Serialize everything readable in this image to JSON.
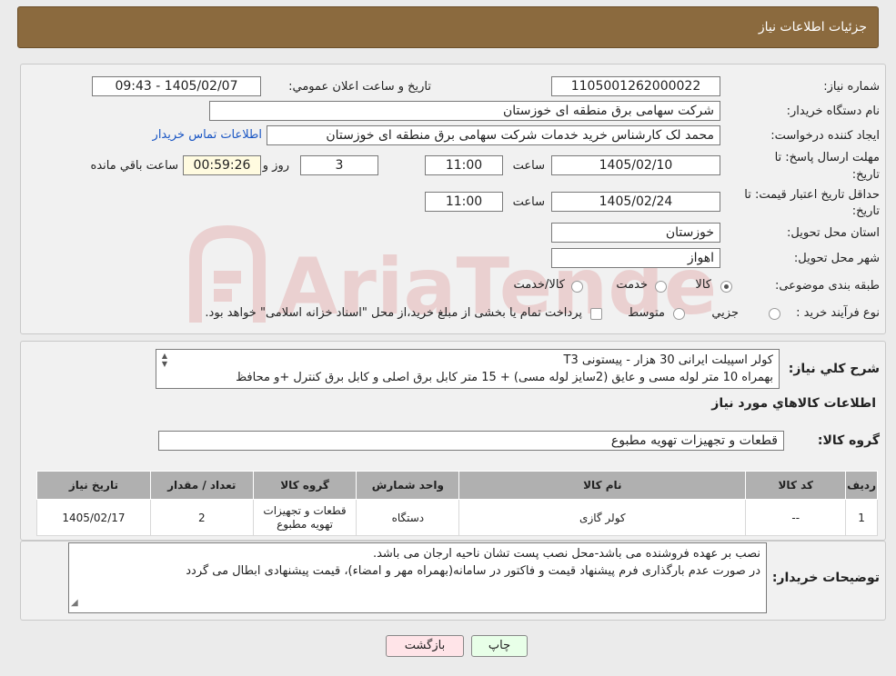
{
  "header": {
    "title": "جزئیات اطلاعات نیاز"
  },
  "form": {
    "need_number_label": "شماره نیاز:",
    "need_number": "1105001262000022",
    "announce_label": "تاریخ و ساعت اعلان عمومي:",
    "announce_value": "1405/02/07 - 09:43",
    "buyer_label": "نام دستگاه خريدار:",
    "buyer_value": "شرکت سهامی برق منطقه ای خوزستان",
    "creator_label": "ايجاد کننده درخواست:",
    "creator_value": "محمد لک کارشناس خرید خدمات شرکت سهامی برق منطقه ای خوزستان",
    "contact_link": "اطلاعات تماس خريدار",
    "deadline_label_1": "مهلت ارسال پاسخ: تا",
    "deadline_label_2": "تاريخ:",
    "deadline_date": "1405/02/10",
    "time_label": "ساعت",
    "deadline_time": "11:00",
    "days_value": "3",
    "days_label": "روز و",
    "remaining_time": "00:59:26",
    "remaining_label": "ساعت باقي مانده",
    "validity_label_1": "حداقل تاريخ اعتبار قيمت: تا",
    "validity_label_2": "تاريخ:",
    "validity_date": "1405/02/24",
    "validity_time": "11:00",
    "province_label": "استان محل تحويل:",
    "province_value": "خوزستان",
    "city_label": "شهر محل تحويل:",
    "city_value": "اهواز",
    "category_label": "طبقه بندی موضوعی:",
    "category_options": [
      "کالا",
      "خدمت",
      "کالا/خدمت"
    ],
    "process_label": "نوع فرآيند خريد :",
    "process_options": [
      "جزيي",
      "متوسط"
    ],
    "process_note": "پرداخت تمام یا بخشی از مبلغ خرید،از محل \"اسناد خزانه اسلامی\" خواهد بود."
  },
  "description": {
    "label": "شرح کلي نياز:",
    "line1": "کولر اسپیلت ایرانی 30 هزار - پیستونی T3",
    "line2": "بهمراه 10 متر لوله مسی و عایق (2سایز لوله مسی) + 15 متر کابل برق اصلی و کابل برق کنترل +و محافظ"
  },
  "goods": {
    "section_title": "اطلاعات کالاهاي مورد نياز",
    "group_label": "گروه کالا:",
    "group_value": "قطعات و تجهیزات تهویه مطبوع",
    "columns": [
      "رديف",
      "کد کالا",
      "نام کالا",
      "واحد شمارش",
      "گروه کالا",
      "تعداد / مقدار",
      "تاريخ نياز"
    ],
    "rows": [
      {
        "row": "1",
        "code": "--",
        "name": "کولر گازی",
        "unit": "دستگاه",
        "group": "قطعات و تجهیزات تهویه مطبوع",
        "qty": "2",
        "date": "1405/02/17"
      }
    ]
  },
  "notes": {
    "label": "توضيحات خريدار:",
    "line1": "نصب بر عهده فروشنده می باشد-محل نصب پست تشان ناحیه ارجان می باشد.",
    "line2": "در صورت عدم بارگذاری فرم پیشنهاد قیمت و فاکتور در سامانه(بهمراه مهر و امضاء)، قیمت پیشنهادی ابطال می گردد"
  },
  "buttons": {
    "print": "چاپ",
    "back": "بازگشت"
  },
  "watermark": {
    "text": "AriaTender.neT"
  }
}
